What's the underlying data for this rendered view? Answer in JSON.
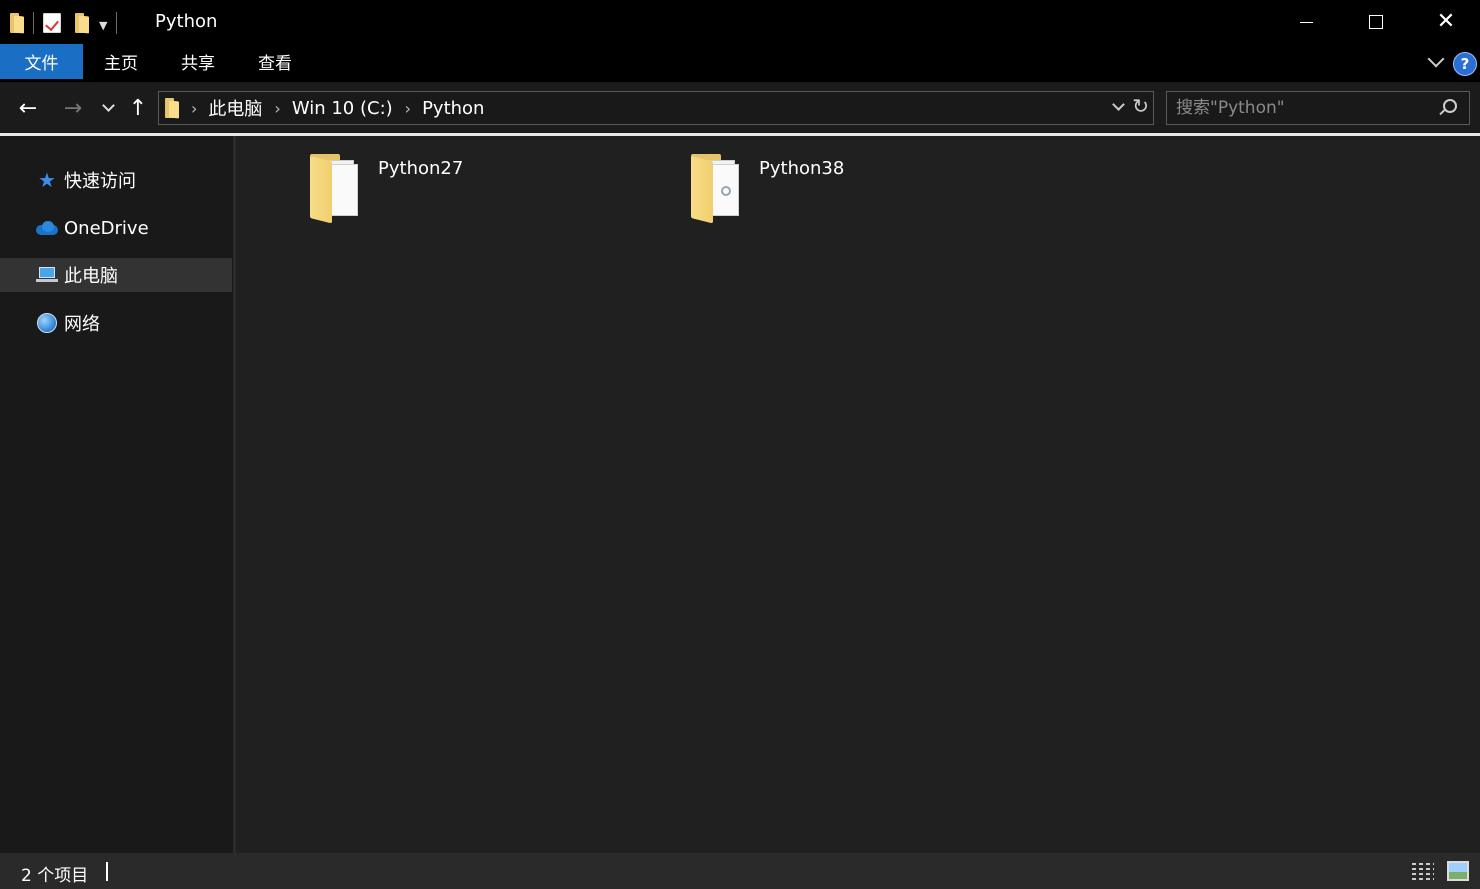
{
  "window": {
    "title": "Python",
    "minimize_label": "",
    "maximize_label": "",
    "close_label": "✕"
  },
  "ribbon": {
    "tabs": [
      {
        "label": "文件",
        "active": true
      },
      {
        "label": "主页"
      },
      {
        "label": "共享"
      },
      {
        "label": "查看"
      }
    ],
    "help_label": "?"
  },
  "navigation": {
    "back_glyph": "←",
    "forward_glyph": "→",
    "up_glyph": "↑",
    "breadcrumb": [
      "此电脑",
      "Win 10 (C:)",
      "Python"
    ],
    "breadcrumb_separator": "›",
    "refresh_glyph": "↻",
    "search_placeholder": "搜索\"Python\""
  },
  "sidebar": {
    "items": [
      {
        "label": "快速访问",
        "icon": "star-icon"
      },
      {
        "label": "OneDrive",
        "icon": "cloud-icon"
      },
      {
        "label": "此电脑",
        "icon": "computer-icon",
        "selected": true
      },
      {
        "label": "网络",
        "icon": "network-icon"
      }
    ]
  },
  "content": {
    "items": [
      {
        "name": "Python27",
        "icon": "folder-icon"
      },
      {
        "name": "Python38",
        "icon": "folder-icon"
      }
    ]
  },
  "status": {
    "item_count": "2 个项目"
  },
  "colors": {
    "accent": "#1a6fc4",
    "window_bg": "#000000",
    "content_bg": "#202020",
    "sidebar_bg": "#191919",
    "selected_bg": "#333333"
  }
}
